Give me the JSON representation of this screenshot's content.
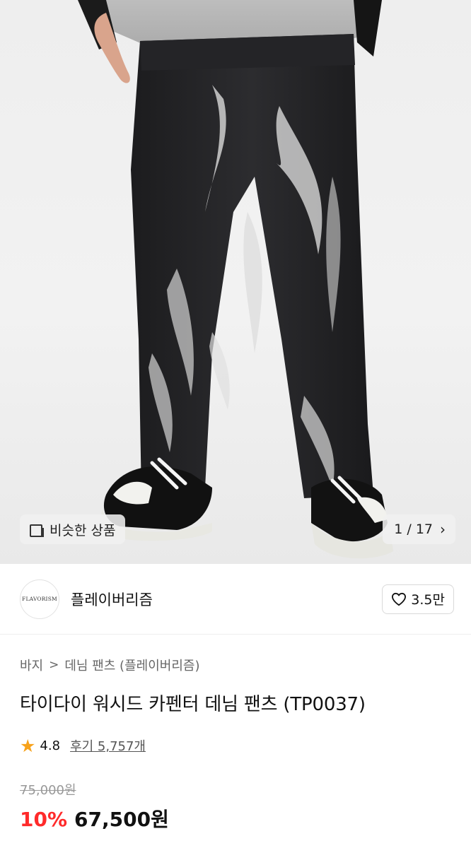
{
  "gallery": {
    "similar_label": "비슷한 상품",
    "current_page": "1",
    "total_pages": "17",
    "page_text": "1 / 17",
    "icons": {
      "similar": "similar-items-icon",
      "next": "chevron-right-icon"
    }
  },
  "brand": {
    "logo_text": "FLAVORISM",
    "name": "플레이버리즘",
    "like_count": "3.5만",
    "icons": {
      "like": "heart-outline-icon"
    }
  },
  "product": {
    "breadcrumb": [
      "바지",
      "데님 팬츠 (플레이버리즘)"
    ],
    "title": "타이다이 워시드 카펜터 데님 팬츠 (TP0037)",
    "rating": "4.8",
    "review_text": "후기 5,757개",
    "original_price": "75,000원",
    "discount": "10%",
    "price": "67,500원"
  },
  "colors": {
    "accent_discount": "#ff2a2a",
    "star": "#f7a21b",
    "background": "#ffffff"
  }
}
